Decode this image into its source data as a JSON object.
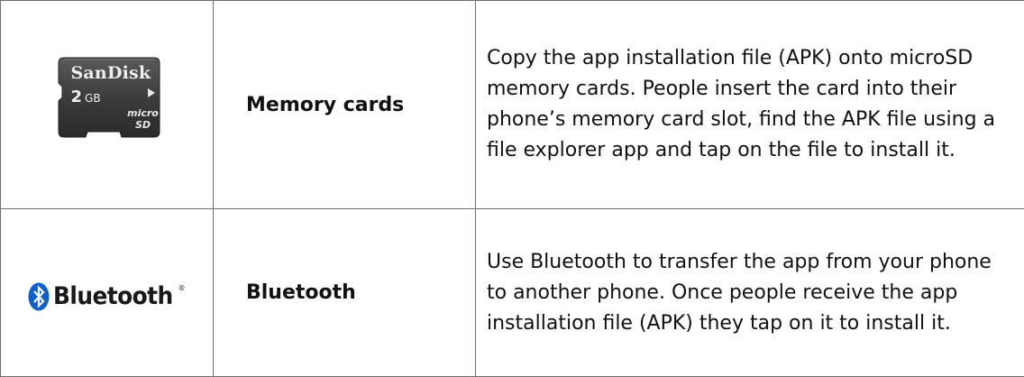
{
  "rows": [
    {
      "icon": "microsd-card-icon",
      "logo": {
        "brand": "SanDisk",
        "capacity": "2",
        "capacity_unit": "GB",
        "format": "micro SD"
      },
      "label": "Memory cards",
      "description": "Copy the app installation file (APK) onto microSD memory cards. People insert the card into their phone’s memory card slot, find the APK file using a file explorer app and tap on the file to install it."
    },
    {
      "icon": "bluetooth-icon",
      "logo": {
        "wordmark": "Bluetooth",
        "registered": "®"
      },
      "label": "Bluetooth",
      "description": "Use Bluetooth to transfer the app from your phone to another phone. Once people receive the app installation file (APK) they tap on it to install it."
    }
  ],
  "colors": {
    "border": "#6f6f6f",
    "text": "#111111",
    "bluetooth_blue": "#1060c8",
    "card_body": "#3c3c3c"
  }
}
